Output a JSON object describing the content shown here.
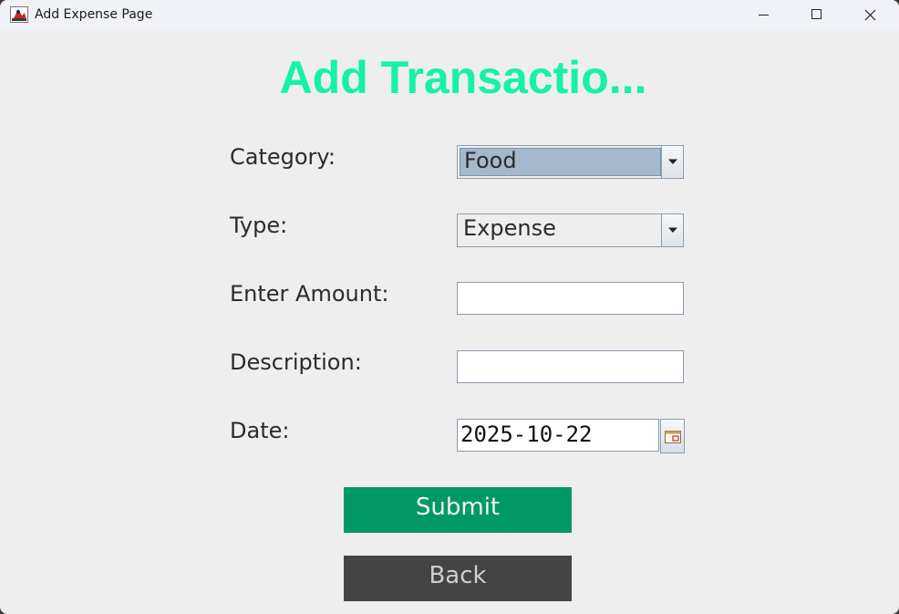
{
  "window": {
    "title": "Add Expense Page"
  },
  "heading": "Add Transactio...",
  "form": {
    "category_label": "Category:",
    "category_value": "Food",
    "type_label": "Type:",
    "type_value": "Expense",
    "amount_label": "Enter Amount:",
    "amount_value": "",
    "description_label": "Description:",
    "description_value": "",
    "date_label": "Date:",
    "date_value": "2025-10-22"
  },
  "buttons": {
    "submit_label": "Submit",
    "back_label": "Back"
  },
  "colors": {
    "heading": "#14f2a6",
    "submit_bg": "#009966",
    "back_bg": "#444444",
    "selected_bg": "#a3b8cc"
  },
  "icons": {
    "app": "app-icon",
    "minimize": "minimize-icon",
    "maximize": "maximize-icon",
    "close": "close-icon",
    "dropdown": "chevron-down-icon",
    "calendar": "calendar-icon"
  }
}
